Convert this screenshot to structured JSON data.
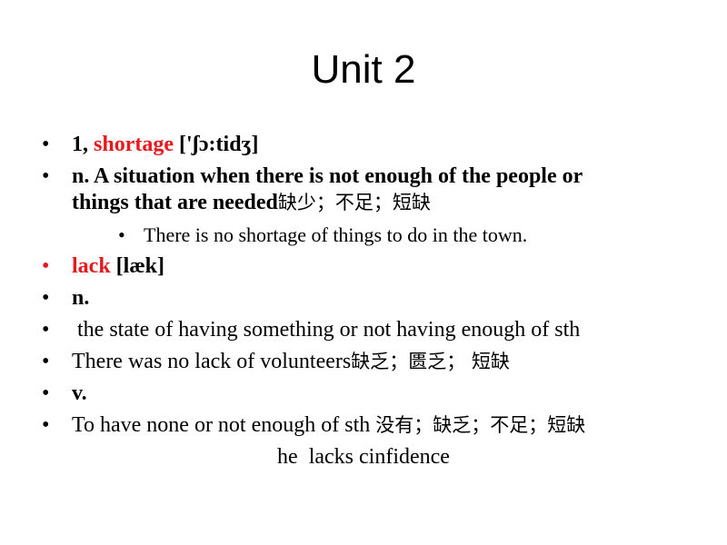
{
  "slide": {
    "title": "Unit 2",
    "accent_color": "#e8191c",
    "items": [
      {
        "num": "1, ",
        "word": "shortage",
        "phonetic": " ['ʃɔ:tidʒ]"
      },
      {
        "line1": "n.  A situation when there is not enough of the people or",
        "line2": "things that are needed",
        "line2_cjk": "缺少；不足；短缺"
      },
      {
        "text": "There is no shortage of things to do in the town."
      },
      {
        "word": "lack",
        "phonetic": " [læk]"
      },
      {
        "text": "n."
      },
      {
        "text": " the state of having something or not having enough of sth"
      },
      {
        "text": "There was no lack of volunteers",
        "cjk": "缺乏；匮乏； 短缺"
      },
      {
        "text": "v."
      },
      {
        "text": "To have none or not enough of sth ",
        "cjk": "没有；缺乏；不足；短缺"
      },
      {
        "text": "he  lacks cinfidence"
      }
    ],
    "bullet_glyph": "•"
  }
}
